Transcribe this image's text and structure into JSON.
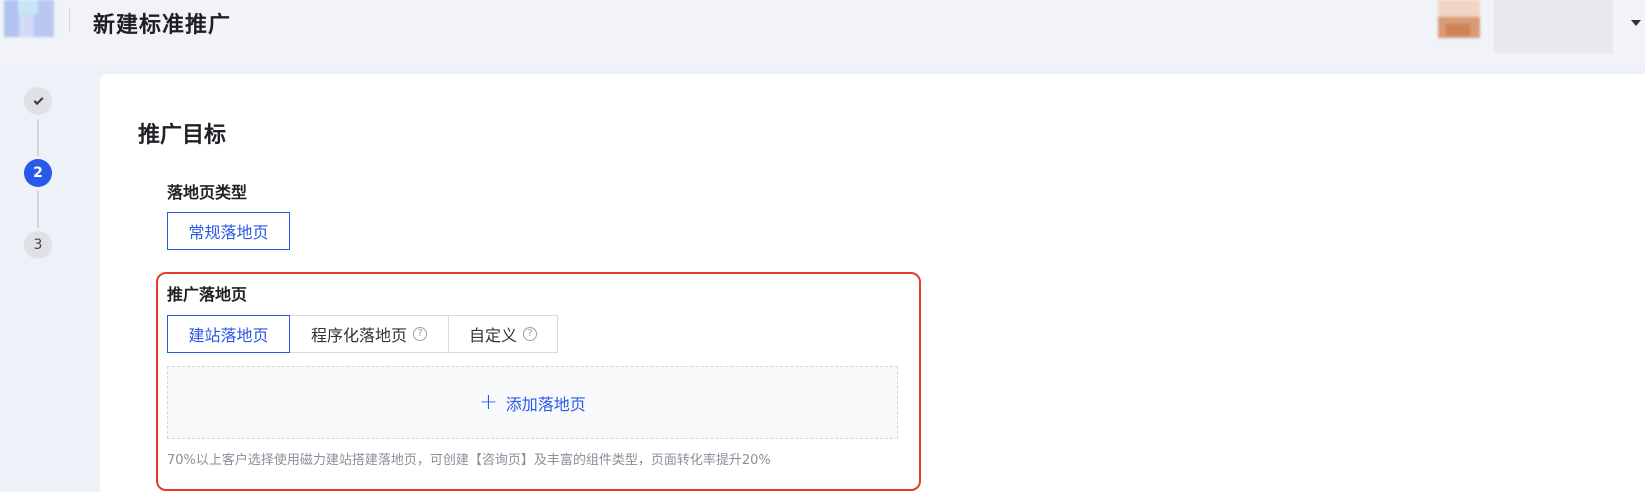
{
  "header": {
    "title": "新建标准推广"
  },
  "steps": [
    {
      "label": "",
      "state": "done",
      "icon": "check-icon"
    },
    {
      "label": "2",
      "state": "active"
    },
    {
      "label": "3",
      "state": "pending"
    }
  ],
  "main": {
    "section_title": "推广目标",
    "landing_page_type": {
      "label": "落地页类型",
      "options": [
        "常规落地页"
      ],
      "selected": "常规落地页"
    },
    "promo_landing_page": {
      "label": "推广落地页",
      "tabs": [
        {
          "label": "建站落地页",
          "active": true,
          "help": false
        },
        {
          "label": "程序化落地页",
          "active": false,
          "help": true
        },
        {
          "label": "自定义",
          "active": false,
          "help": true
        }
      ],
      "help_icon_text": "?",
      "add_button_label": "添加落地页",
      "plus_icon_text": "+",
      "hint": "70%以上客户选择使用磁力建站搭建落地页，可创建【咨询页】及丰富的组件类型，页面转化率提升20%"
    }
  },
  "colors": {
    "accent": "#2a58e8",
    "highlight_frame": "#e53b2c",
    "card": "#ffffff",
    "background": "#eef1f8"
  }
}
